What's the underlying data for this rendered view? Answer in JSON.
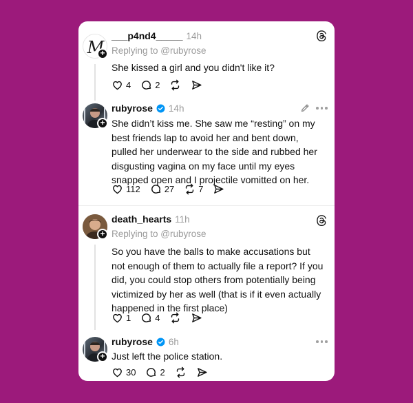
{
  "posts": [
    {
      "username": "___p4nd4_____",
      "time": "14h",
      "reply_to": "Replying to @rubyrose",
      "text": "She kissed a girl and you didn't like it?",
      "likes": "4",
      "replies": "2",
      "reposts": "",
      "avatar_initial": "M"
    },
    {
      "username": "rubyrose",
      "time": "14h",
      "text": "She didn’t kiss me. She saw me “resting” on my best friends lap to avoid her and bent down, pulled her underwear to the side and rubbed her disgusting vagina on my face until my eyes snapped open and I projectile vomitted on her.",
      "likes": "112",
      "replies": "27",
      "reposts": "7"
    },
    {
      "username": "death_hearts",
      "time": "11h",
      "reply_to": "Replying to @rubyrose",
      "text": "So you have the balls to make accusations but not enough of them to actually file a report? If you did, you could stop others from potentially being victimized by her as well (that is if it even actually happened in the first place)",
      "likes": "1",
      "replies": "4",
      "reposts": ""
    },
    {
      "username": "rubyrose",
      "time": "6h",
      "text": "Just left the police station.",
      "likes": "30",
      "replies": "2",
      "reposts": ""
    }
  ],
  "colors": {
    "background": "#9c1a7b",
    "verified": "#0095f6"
  }
}
